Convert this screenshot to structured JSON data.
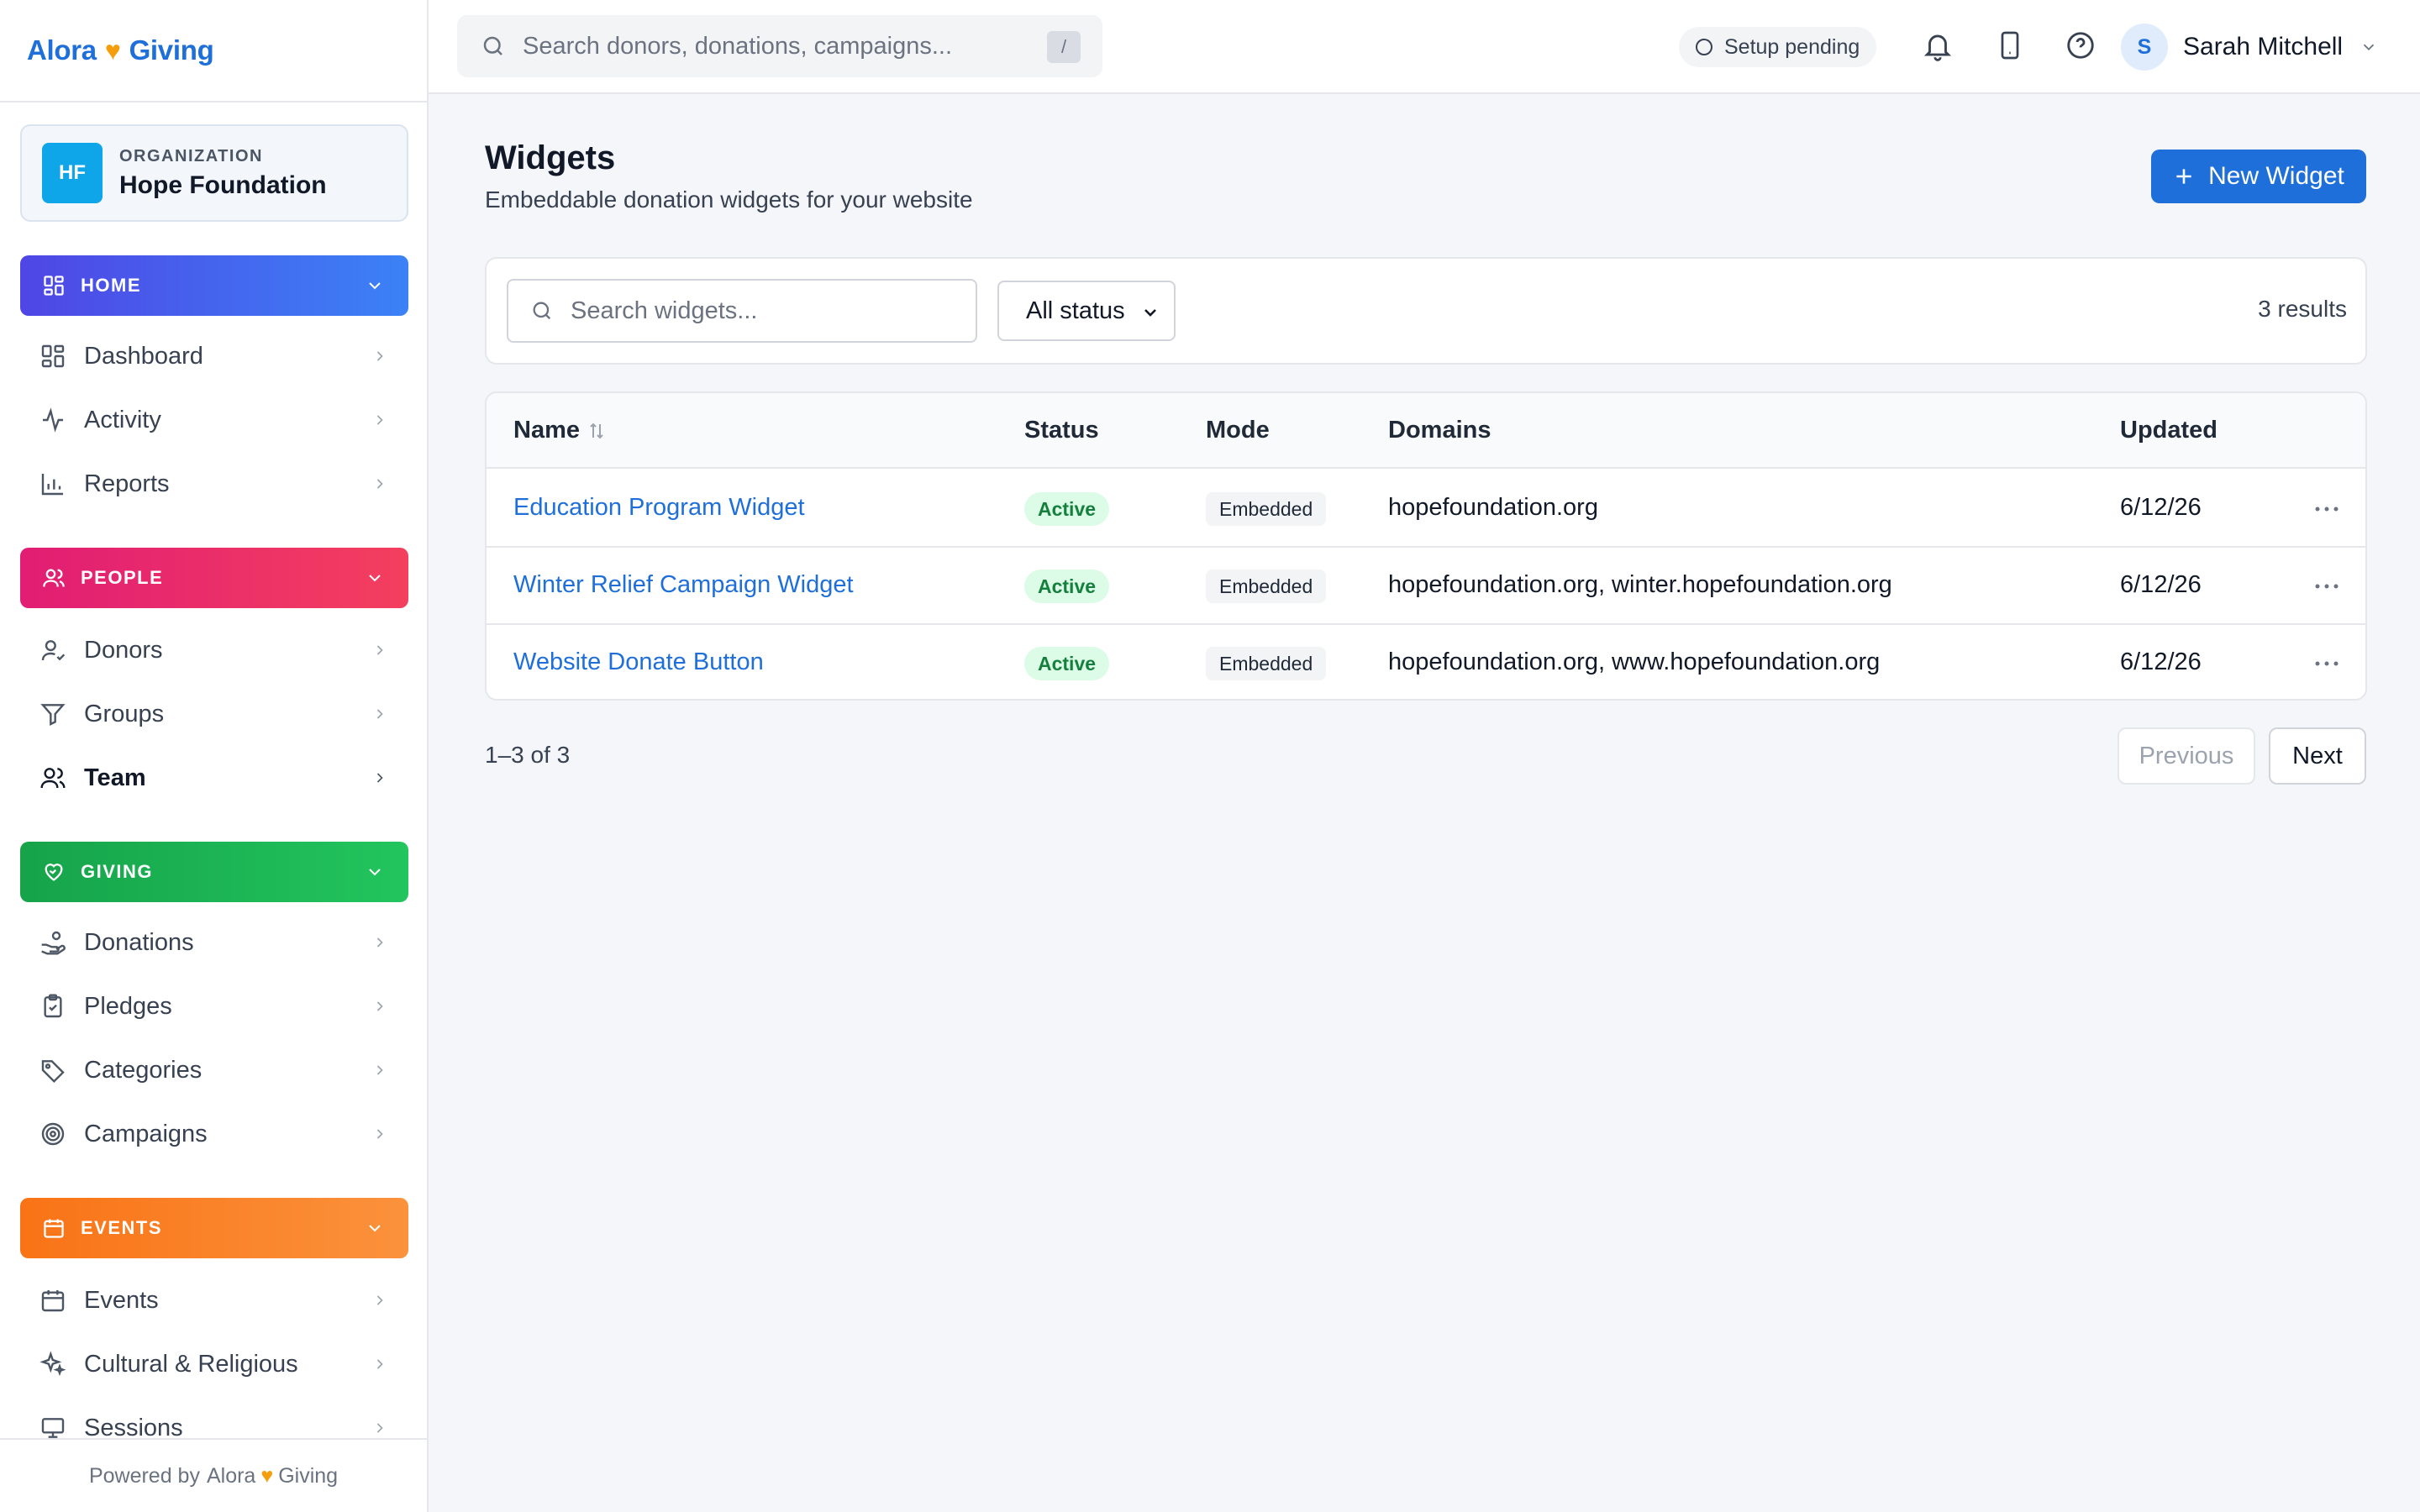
{
  "brand": {
    "left": "Alora",
    "right": "Giving"
  },
  "organization": {
    "kicker": "ORGANIZATION",
    "initials": "HF",
    "name": "Hope Foundation"
  },
  "sidebar": {
    "sections": [
      {
        "label": "HOME",
        "items": [
          "Dashboard",
          "Activity",
          "Reports"
        ]
      },
      {
        "label": "PEOPLE",
        "items": [
          "Donors",
          "Groups",
          "Team"
        ]
      },
      {
        "label": "GIVING",
        "items": [
          "Donations",
          "Pledges",
          "Categories",
          "Campaigns"
        ]
      },
      {
        "label": "EVENTS",
        "items": [
          "Events",
          "Cultural & Religious",
          "Sessions"
        ]
      }
    ],
    "active_item": "Team",
    "powered_by": "Powered by",
    "powered_brand_left": "Alora",
    "powered_brand_right": "Giving"
  },
  "topbar": {
    "search_placeholder": "Search donors, donations, campaigns...",
    "search_shortcut": "/",
    "setup_status": "Setup pending",
    "user_initial": "S",
    "user_name": "Sarah Mitchell"
  },
  "page": {
    "title": "Widgets",
    "subtitle": "Embeddable donation widgets for your website",
    "new_button": "New Widget"
  },
  "filters": {
    "search_placeholder": "Search widgets...",
    "status_selected": "All status",
    "results": "3 results"
  },
  "table": {
    "columns": [
      "Name",
      "Status",
      "Mode",
      "Domains",
      "Updated"
    ],
    "rows": [
      {
        "name": "Education Program Widget",
        "status": "Active",
        "mode": "Embedded",
        "domains": "hopefoundation.org",
        "updated": "6/12/26"
      },
      {
        "name": "Winter Relief Campaign Widget",
        "status": "Active",
        "mode": "Embedded",
        "domains": "hopefoundation.org, winter.hopefoundation.org",
        "updated": "6/12/26"
      },
      {
        "name": "Website Donate Button",
        "status": "Active",
        "mode": "Embedded",
        "domains": "hopefoundation.org, www.hopefoundation.org",
        "updated": "6/12/26"
      }
    ]
  },
  "pagination": {
    "range": "1–3 of 3",
    "previous": "Previous",
    "next": "Next"
  },
  "colors": {
    "brand_blue": "#1e6fd9",
    "heart": "#f59e0b",
    "home": "#4f46e5",
    "people": "#e11d74",
    "giving": "#16a34a",
    "events": "#f97316",
    "active_badge": "#15803d"
  }
}
